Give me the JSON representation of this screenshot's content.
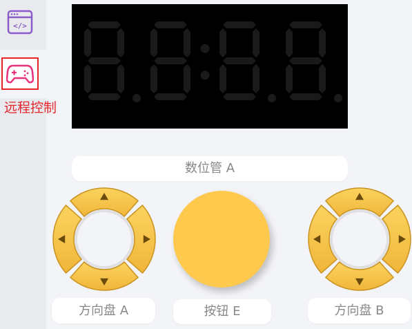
{
  "sidebar": {
    "items": [
      {
        "icon": "code-window-icon",
        "label": ""
      },
      {
        "icon": "gamepad-icon",
        "label": "远程控制",
        "active": true
      }
    ]
  },
  "display": {
    "name": "数位管 A",
    "value": "8.8:8.8."
  },
  "dpad_a": {
    "label": "方向盘 A"
  },
  "button_e": {
    "label": "按钮 E"
  },
  "dpad_b": {
    "label": "方向盘 B"
  },
  "colors": {
    "accent_red": "#e4262a",
    "purple_icon": "#8a5cc9",
    "pink_icon": "#e8317a",
    "dpad_yellow": "#f6c244",
    "button_yellow": "#fec94c"
  }
}
